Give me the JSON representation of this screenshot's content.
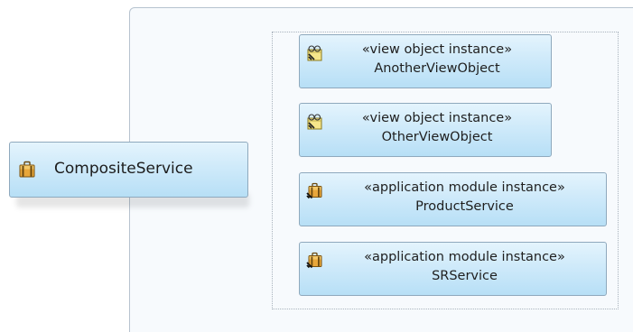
{
  "diagram": {
    "composite": {
      "icon": "application-module-icon",
      "label": "CompositeService"
    },
    "instances": [
      {
        "icon": "view-object-icon",
        "stereotype": "«view object instance»",
        "name": "AnotherViewObject"
      },
      {
        "icon": "view-object-icon",
        "stereotype": "«view object instance»",
        "name": "OtherViewObject"
      },
      {
        "icon": "application-module-instance-icon",
        "stereotype": "«application module instance»",
        "name": "ProductService"
      },
      {
        "icon": "application-module-instance-icon",
        "stereotype": "«application module instance»",
        "name": "SRService"
      }
    ]
  }
}
